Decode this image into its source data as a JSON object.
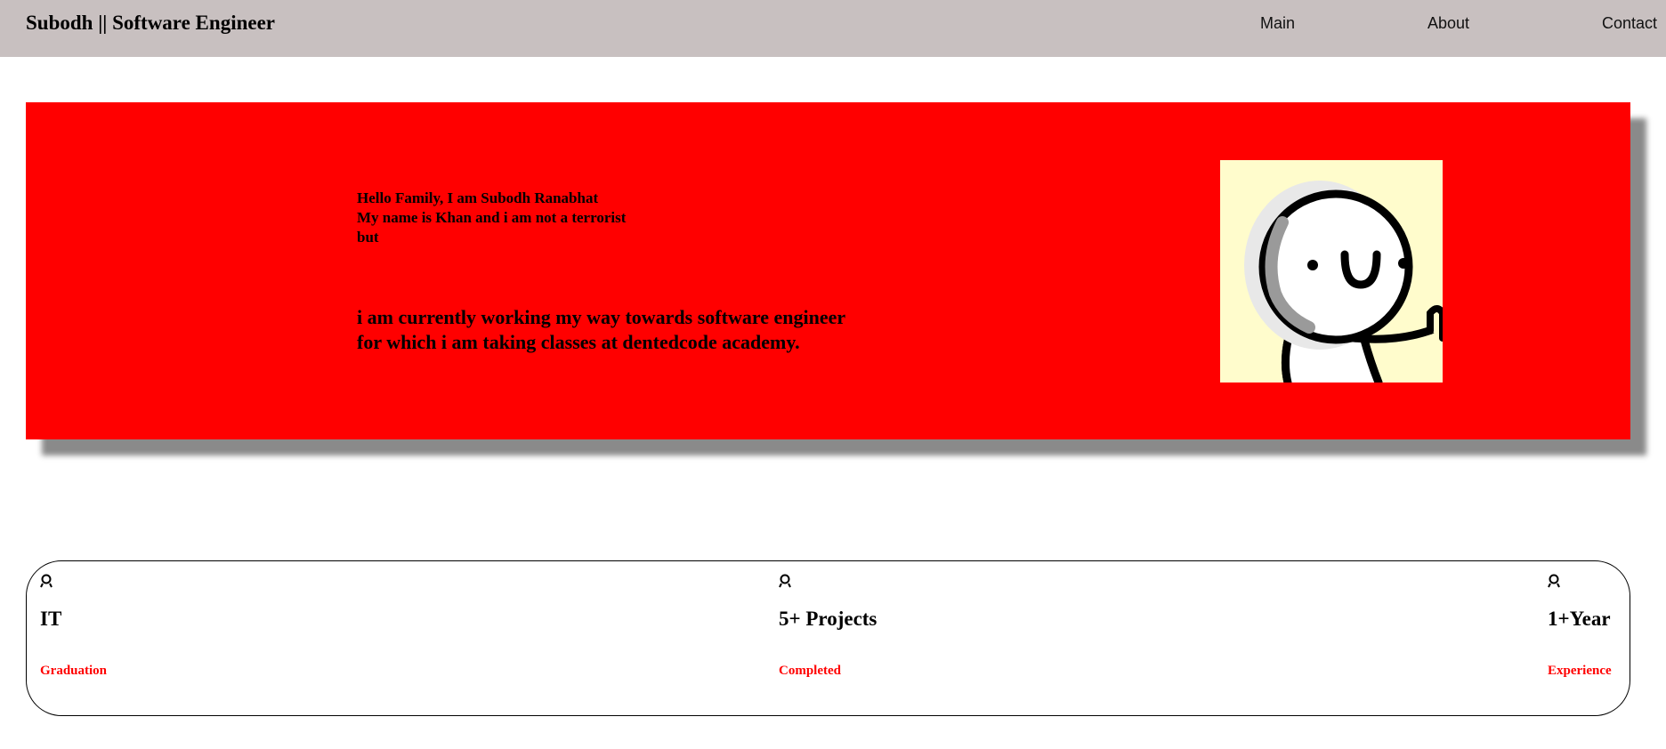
{
  "header": {
    "brand": "Subodh || Software Engineer",
    "nav": [
      {
        "label": "Main"
      },
      {
        "label": "About"
      },
      {
        "label": "Contact"
      }
    ],
    "background": "#c8c0c0"
  },
  "hero": {
    "background": "#ff0000",
    "greeting_lines": [
      "Hello Family, I am Subodh Ranabhat",
      "My name is Khan and i am not a terrorist",
      "but"
    ],
    "tagline_lines": [
      "i am currently working my way towards software engineer",
      "for which i am taking classes at dentedcode academy."
    ],
    "avatar_icon": "smiling-stick-figure-thumbs-up"
  },
  "stats": {
    "items": [
      {
        "icon": "award-ribbon-icon",
        "value": "IT",
        "label": "Graduation"
      },
      {
        "icon": "award-ribbon-icon",
        "value": "5+ Projects",
        "label": "Completed"
      },
      {
        "icon": "award-ribbon-icon",
        "value": "1+Year",
        "label": "Experience"
      }
    ],
    "label_color": "#ff0000"
  }
}
